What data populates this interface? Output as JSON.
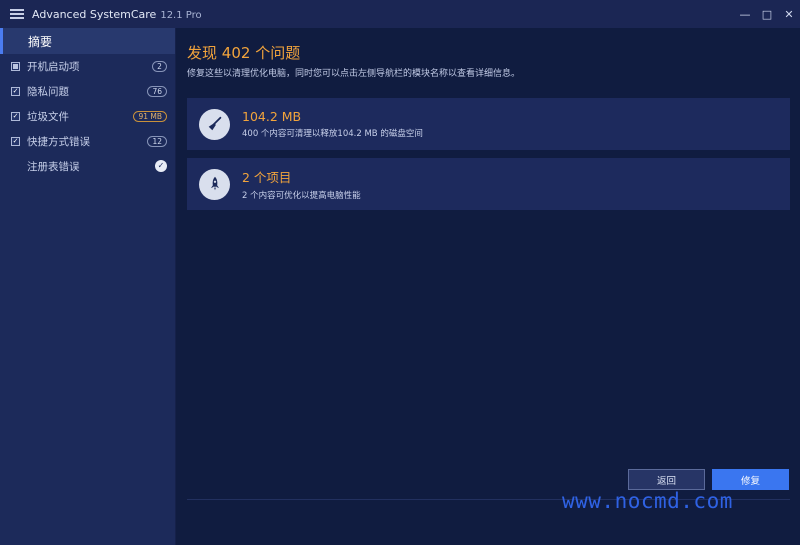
{
  "window": {
    "title": "Advanced SystemCare",
    "version": "12.1 Pro",
    "controls": {
      "minimize": "—",
      "maximize": "□",
      "close": "✕"
    }
  },
  "sidebar": {
    "summary": "摘要",
    "items": [
      {
        "label": "开机启动项",
        "badge": "2",
        "check": "square"
      },
      {
        "label": "隐私问题",
        "badge": "76",
        "check": "checked"
      },
      {
        "label": "垃圾文件",
        "badge": "91 MB",
        "check": "checked"
      },
      {
        "label": "快捷方式错误",
        "badge": "12",
        "check": "checked"
      },
      {
        "label": "注册表错误",
        "badge": "",
        "check": "none"
      }
    ]
  },
  "main": {
    "headline_prefix": "发现",
    "issue_count": "402",
    "headline_suffix": "个问题",
    "subline": "修复这些以清理优化电脑，同时您可以点击左侧导航栏的模块名称以查看详细信息。",
    "cards": [
      {
        "title": "104.2 MB",
        "desc": "400 个内容可清理以释放104.2 MB 的磁盘空间",
        "icon": "broom-icon"
      },
      {
        "title": "2 个项目",
        "desc": "2 个内容可优化以提高电脑性能",
        "icon": "rocket-icon"
      }
    ],
    "back_label": "返回",
    "fix_label": "修复"
  },
  "watermark": "www.nocmd.com",
  "colors": {
    "accent": "#f2a43c",
    "primary_button": "#3a76f0",
    "background": "#101c40"
  }
}
